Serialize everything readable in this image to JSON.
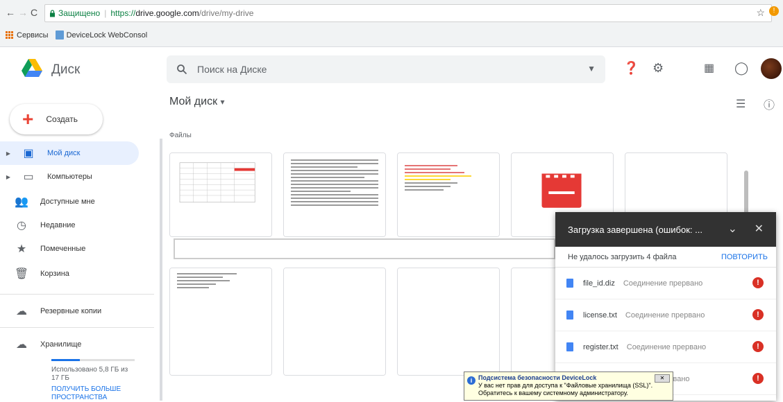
{
  "browser": {
    "secure_label": "Защищено",
    "url_proto": "https://",
    "url_host": "drive.google.com",
    "url_path": "/drive/my-drive",
    "bookmarks": [
      {
        "label": "Сервисы"
      },
      {
        "label": "DeviceLock WebConsol"
      }
    ]
  },
  "drive": {
    "brand": "Диск",
    "search_placeholder": "Поиск на Диске",
    "create_label": "Создать",
    "title": "Мой диск",
    "files_heading": "Файлы",
    "nav": [
      {
        "label": "Мой диск",
        "icon": "drive-icon",
        "active": true
      },
      {
        "label": "Компьютеры",
        "icon": "computer-icon"
      },
      {
        "label": "Доступные мне",
        "icon": "shared-icon"
      },
      {
        "label": "Недавние",
        "icon": "clock-icon"
      },
      {
        "label": "Помеченные",
        "icon": "star-icon"
      },
      {
        "label": "Корзина",
        "icon": "trash-icon"
      },
      {
        "label": "Резервные копии",
        "icon": "cloud-icon"
      },
      {
        "label": "Хранилище",
        "icon": "storage-cloud-icon"
      }
    ],
    "storage_used": "Использовано 5,8 ГБ из 17 ГБ",
    "storage_used_fraction": 0.34,
    "storage_upgrade": "ПОЛУЧИТЬ БОЛЬШЕ ПРОСТРАНСТВА"
  },
  "upload": {
    "title": "Загрузка завершена (ошибок: ...",
    "summary": "Не удалось загрузить 4 файла",
    "retry": "ПОВТОРИТЬ",
    "items": [
      {
        "name": "file_id.diz",
        "status": "Соединение прервано"
      },
      {
        "name": "license.txt",
        "status": "Соединение прервано"
      },
      {
        "name": "register.txt",
        "status": "Соединение прервано"
      },
      {
        "name": "",
        "status": "е прервано"
      }
    ]
  },
  "toast": {
    "title": "Подсистема безопасности DeviceLock",
    "body": "У вас нет прав для доступа к \"Файловые хранилища (SSL)\". Обратитесь к вашему системному администратору."
  }
}
